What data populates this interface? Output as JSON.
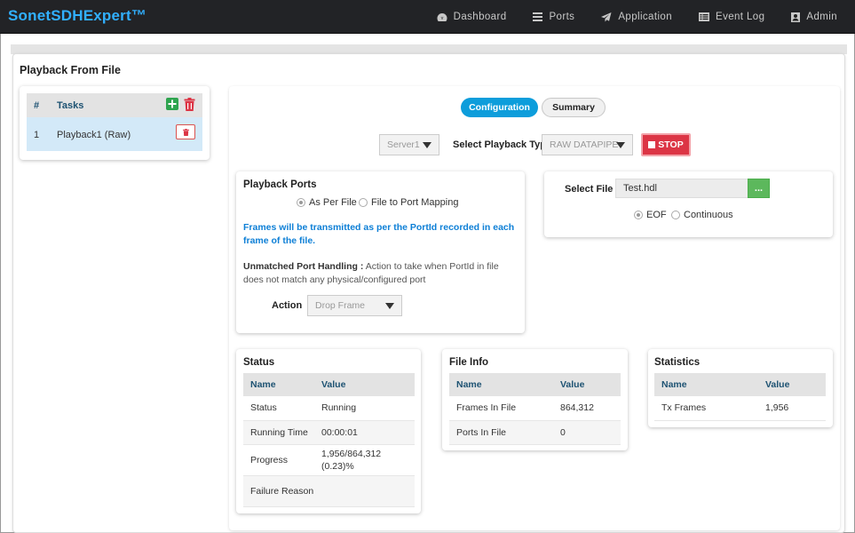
{
  "app": {
    "brand": "SonetSDHExpert™"
  },
  "nav": {
    "items": [
      {
        "label": "Dashboard",
        "icon": "dashboard-icon"
      },
      {
        "label": "Ports",
        "icon": "list-icon"
      },
      {
        "label": "Application",
        "icon": "paper-plane-icon"
      },
      {
        "label": "Event Log",
        "icon": "list-alt-icon"
      },
      {
        "label": "Admin",
        "icon": "user-icon"
      }
    ]
  },
  "page": {
    "title": "Playback From File"
  },
  "tasks": {
    "headers": {
      "num": "#",
      "tasks": "Tasks"
    },
    "rows": [
      {
        "num": "1",
        "name": "Playback1 (Raw)"
      }
    ]
  },
  "tabs": {
    "configuration": "Configuration",
    "summary": "Summary",
    "active": "configuration"
  },
  "toolbar": {
    "server": "Server1",
    "playback_type_label": "Select Playback Type",
    "playback_type": "RAW DATAPIPE",
    "stop_label": "STOP"
  },
  "playback_ports": {
    "title": "Playback Ports",
    "option_as_per_file": "As Per File",
    "option_mapping": "File to Port Mapping",
    "selected": "as_per_file",
    "info": "Frames will be transmitted as per the PortId recorded in each frame of the file.",
    "unmatched_label": "Unmatched Port Handling :",
    "unmatched_text": "Action to take when PortId in file does not match any physical/configured port",
    "action_label": "Action",
    "action_value": "Drop Frame"
  },
  "select_file": {
    "label": "Select File",
    "value": "Test.hdl",
    "browse_label": "...",
    "option_eof": "EOF",
    "option_continuous": "Continuous",
    "selected": "eof"
  },
  "status": {
    "title": "Status",
    "headers": {
      "name": "Name",
      "value": "Value"
    },
    "rows": [
      {
        "name": "Status",
        "value": "Running"
      },
      {
        "name": "Running Time",
        "value": "00:00:01"
      },
      {
        "name": "Progress",
        "value": "1,956/864,312 (0.23)%"
      },
      {
        "name": "Failure Reason",
        "value": ""
      }
    ]
  },
  "file_info": {
    "title": "File Info",
    "headers": {
      "name": "Name",
      "value": "Value"
    },
    "rows": [
      {
        "name": "Frames In File",
        "value": "864,312"
      },
      {
        "name": "Ports In File",
        "value": "0"
      }
    ]
  },
  "statistics": {
    "title": "Statistics",
    "headers": {
      "name": "Name",
      "value": "Value"
    },
    "rows": [
      {
        "name": "Tx Frames",
        "value": "1,956"
      }
    ]
  },
  "colors": {
    "brand": "#31b0ff",
    "navbar_bg": "#222326",
    "primary": "#0d9ddb",
    "danger": "#dc3545",
    "success": "#5cb85c",
    "table_header_text": "#1d5272",
    "info_text": "#0d7fd6",
    "selected_row": "#d3e9f8"
  }
}
